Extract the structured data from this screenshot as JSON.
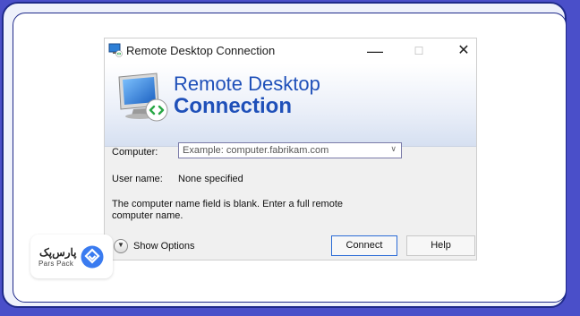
{
  "window": {
    "title": "Remote Desktop Connection",
    "controls": {
      "minimize": "—",
      "maximize": "☐",
      "close": "✕"
    }
  },
  "banner": {
    "line1": "Remote Desktop",
    "line2": "Connection"
  },
  "form": {
    "computer_label": "Computer:",
    "computer_placeholder": "Example: computer.fabrikam.com",
    "username_label": "User name:",
    "username_value": "None specified",
    "message_line1": "The computer name field is blank. Enter a full remote",
    "message_line2": "computer name."
  },
  "footer": {
    "show_options_label": "Show Options",
    "connect_label": "Connect",
    "help_label": "Help"
  },
  "watermark": {
    "brand_fa": "پارس‌پک",
    "brand_en": "Pars Pack"
  },
  "colors": {
    "outer_background": "#4a4fc9",
    "frame_background": "#eef1fb",
    "frame_border": "#1f2a8a",
    "banner_text": "#1f50b9",
    "primary_button_border": "#2b6bd6",
    "logo_accent": "#3a7bf0"
  }
}
